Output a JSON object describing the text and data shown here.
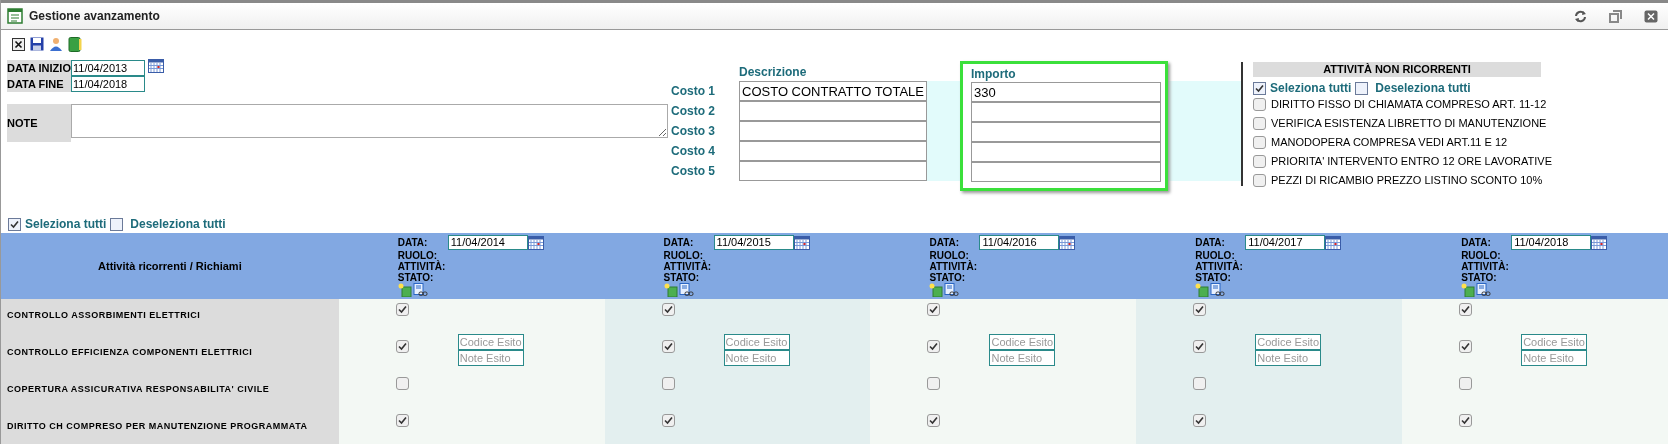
{
  "window": {
    "title": "Gestione avanzamento"
  },
  "dates": [
    {
      "label": "DATA INIZIO",
      "value": "11/04/2013"
    },
    {
      "label": "DATA FINE",
      "value": "11/04/2018"
    }
  ],
  "note": {
    "label": "NOTE"
  },
  "costs": {
    "description_header": "Descrizione",
    "amount_header": "Importo",
    "amount_highlighted": true,
    "rows": [
      {
        "label": "Costo 1",
        "description": "COSTO CONTRATTO TOTALE",
        "amount": "330"
      },
      {
        "label": "Costo 2"
      },
      {
        "label": "Costo 3"
      },
      {
        "label": "Costo 4"
      },
      {
        "label": "Costo 5"
      }
    ]
  },
  "non_recurring": {
    "title": "ATTIVITÀ NON RICORRENTI",
    "select_all": {
      "label": "Seleziona tutti",
      "checked": true
    },
    "deselect_all": {
      "label": "Deseleziona tutti",
      "checked": false
    },
    "items": [
      {
        "label": "DIRITTO FISSO DI CHIAMATA COMPRESO ART. 11-12",
        "checked": false
      },
      {
        "label": "VERIFICA ESISTENZA LIBRETTO DI MANUTENZIONE",
        "checked": false
      },
      {
        "label": "MANODOPERA COMPRESA VEDI ART.11 E 12",
        "checked": false
      },
      {
        "label": "PRIORITA' INTERVENTO ENTRO 12 ORE LAVORATIVE",
        "checked": false
      },
      {
        "label": "PEZZI DI RICAMBIO PREZZO LISTINO SCONTO 10%",
        "checked": false
      }
    ]
  },
  "select_all": {
    "label": "Seleziona tutti",
    "checked": true
  },
  "deselect_all": {
    "label": "Deseleziona tutti",
    "checked": false
  },
  "table": {
    "header": "Attività ricorrenti / Richiami",
    "periods": [
      {
        "date_label": "DATA:",
        "date": "11/04/2014",
        "role_label": "RUOLO:",
        "activity_label": "ATTIVITÀ:",
        "status_label": "STATO:"
      },
      {
        "date_label": "DATA:",
        "date": "11/04/2015",
        "role_label": "RUOLO:",
        "activity_label": "ATTIVITÀ:",
        "status_label": "STATO:"
      },
      {
        "date_label": "DATA:",
        "date": "11/04/2016",
        "role_label": "RUOLO:",
        "activity_label": "ATTIVITÀ:",
        "status_label": "STATO:"
      },
      {
        "date_label": "DATA:",
        "date": "11/04/2017",
        "role_label": "RUOLO:",
        "activity_label": "ATTIVITÀ:",
        "status_label": "STATO:"
      },
      {
        "date_label": "DATA:",
        "date": "11/04/2018",
        "role_label": "RUOLO:",
        "activity_label": "ATTIVITÀ:",
        "status_label": "STATO:"
      }
    ],
    "rows": [
      {
        "label": "CONTROLLO ASSORBIMENTI ELETTRICI",
        "cells": [
          {
            "checked": true
          },
          {
            "checked": true
          },
          {
            "checked": true
          },
          {
            "checked": true
          },
          {
            "checked": true
          }
        ]
      },
      {
        "label": "CONTROLLO EFFICIENZA COMPONENTI ELETTRICI",
        "cells": [
          {
            "checked": true,
            "code_placeholder": "Codice Esito",
            "notes_placeholder": "Note Esito"
          },
          {
            "checked": true,
            "code_placeholder": "Codice Esito",
            "notes_placeholder": "Note Esito"
          },
          {
            "checked": true,
            "code_placeholder": "Codice Esito",
            "notes_placeholder": "Note Esito"
          },
          {
            "checked": true,
            "code_placeholder": "Codice Esito",
            "notes_placeholder": "Note Esito"
          },
          {
            "checked": true,
            "code_placeholder": "Codice Esito",
            "notes_placeholder": "Note Esito"
          }
        ]
      },
      {
        "label": "COPERTURA ASSICURATIVA RESPONSABILITA' CIVILE",
        "cells": [
          {
            "checked": false
          },
          {
            "checked": false
          },
          {
            "checked": false
          },
          {
            "checked": false
          },
          {
            "checked": false
          }
        ]
      },
      {
        "label": "DIRITTO CH COMPRESO PER MANUTENZIONE PROGRAMMATA",
        "cells": [
          {
            "checked": true
          },
          {
            "checked": true
          },
          {
            "checked": true
          },
          {
            "checked": true
          },
          {
            "checked": true
          }
        ]
      }
    ]
  }
}
